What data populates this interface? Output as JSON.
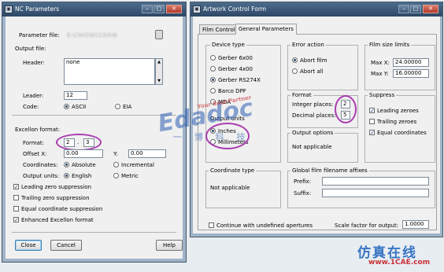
{
  "nc": {
    "title": "NC Parameters",
    "parameter_file_label": "Parameter file:",
    "parameter_file_value": "E:\\CW\\D\\EC23\\S\\N",
    "output_file_label": "Output file:",
    "header_label": "Header:",
    "header_value": "none",
    "leader_label": "Leader:",
    "leader_value": "12",
    "code_label": "Code:",
    "code_options": [
      "ASCII",
      "EIA"
    ],
    "code_selected": "ASCII",
    "excellon_label": "Excellon format:",
    "format_label": "Format:",
    "format_int": "2",
    "format_sep": ".",
    "format_dec": "3",
    "offsetx_label": "Offset X:",
    "offsetx_value": "0.00",
    "offsety_label": "Y:",
    "offsety_value": "0.00",
    "coordinates_label": "Coordinates:",
    "coordinates_options": [
      "Absolute",
      "Incremental"
    ],
    "coordinates_selected": "Absolute",
    "output_units_label": "Output units:",
    "output_units_options": [
      "English",
      "Metric"
    ],
    "output_units_selected": "English",
    "checks": [
      {
        "label": "Leading zero suppression",
        "checked": true
      },
      {
        "label": "Trailing zero suppression",
        "checked": false
      },
      {
        "label": "Equal coordinate suppression",
        "checked": false
      },
      {
        "label": "Enhanced Excellon format",
        "checked": true
      }
    ],
    "close_label": "Close",
    "cancel_label": "Cancel",
    "help_label": "Help"
  },
  "art": {
    "title": "Artwork Control Form",
    "tabs": [
      "Film Control",
      "General Parameters"
    ],
    "active_tab": "General Parameters",
    "device_type_label": "Device type",
    "devices": [
      {
        "label": "Gerber 6x00",
        "selected": false
      },
      {
        "label": "Gerber 4x00",
        "selected": false
      },
      {
        "label": "Gerber RS274X",
        "selected": true
      },
      {
        "label": "Barco DPF",
        "selected": false
      },
      {
        "label": "MDA",
        "selected": false
      }
    ],
    "output_units_label": "Output units",
    "units": [
      {
        "label": "Inches",
        "selected": true
      },
      {
        "label": "Millimeters",
        "selected": false
      }
    ],
    "error_action_label": "Error action",
    "errors": [
      {
        "label": "Abort film",
        "selected": true
      },
      {
        "label": "Abort all",
        "selected": false
      }
    ],
    "format_label": "Format",
    "integer_places_label": "Integer places:",
    "integer_places_value": "2",
    "decimal_places_label": "Decimal places:",
    "decimal_places_value": "5",
    "output_options_label": "Output options",
    "output_options_value": "Not applicable",
    "film_size_label": "Film size limits",
    "maxx_label": "Max X:",
    "maxx_value": "24.00000",
    "maxy_label": "Max Y:",
    "maxy_value": "16.00000",
    "suppress_label": "Suppress",
    "suppress": [
      {
        "label": "Leading zeroes",
        "checked": true
      },
      {
        "label": "Trailing zeroes",
        "checked": false
      },
      {
        "label": "Equal coordinates",
        "checked": true
      }
    ],
    "coord_type_label": "Coordinate type",
    "coord_type_value": "Not applicable",
    "global_affixes_label": "Global film filename affixes",
    "prefix_label": "Prefix:",
    "prefix_value": "",
    "suffix_label": "Suffix:",
    "suffix_value": "",
    "continue_label": "Continue with undefined apertures",
    "continue_checked": false,
    "scale_label": "Scale factor for output:",
    "scale_value": "1.0000"
  },
  "watermark": {
    "brand": "Edadoc",
    "brand_sub": "Your Best Partner",
    "cn_line": "一 博 科 技",
    "cae_logo": "仿真在线",
    "cae_url": "www.1CAE.com",
    "colors": {
      "purple": "#a93bb0",
      "brand_blue": "#2f5fb3",
      "cae_red": "#c8262e"
    }
  }
}
